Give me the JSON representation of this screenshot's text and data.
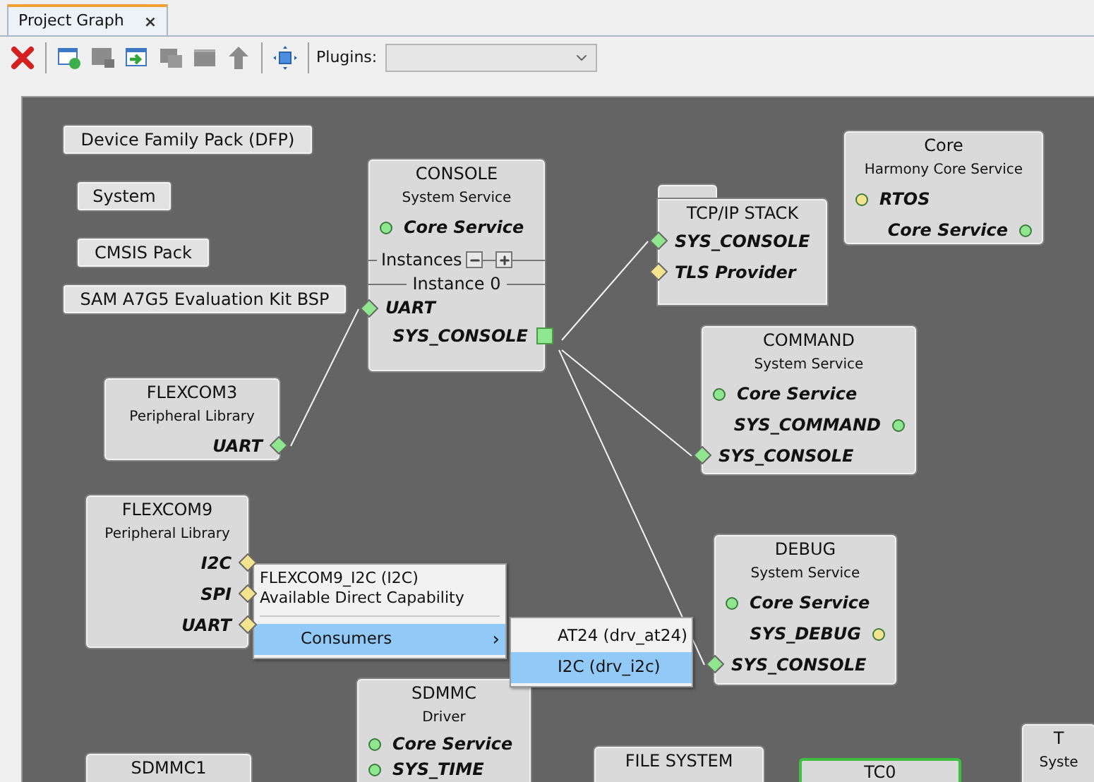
{
  "tab": {
    "label": "Project Graph",
    "close": "×",
    "selected": true
  },
  "toolbar": [
    {
      "kind": "delete",
      "disabled": false
    },
    {
      "kind": "new",
      "disabled": false
    },
    {
      "kind": "remove",
      "disabled": true
    },
    {
      "kind": "import",
      "disabled": false
    },
    {
      "kind": "copy",
      "disabled": true
    },
    {
      "kind": "panel",
      "disabled": true
    },
    {
      "kind": "up",
      "disabled": true
    },
    {
      "kind": "fit",
      "disabled": false
    }
  ],
  "plugins": {
    "label": "Plugins:",
    "disabled": true
  },
  "nodes": [
    {
      "kind": "pack",
      "title": "Device Family Pack (DFP)"
    },
    {
      "kind": "pack",
      "title": "System"
    },
    {
      "kind": "pack",
      "title": "CMSIS Pack"
    },
    {
      "kind": "pack",
      "title": "SAM A7G5 Evaluation Kit BSP"
    },
    {
      "kind": "component",
      "title": "CONSOLE",
      "subtitle": "System Service",
      "selected": false,
      "ports": [
        {
          "label": "Core Service",
          "kind": "dot",
          "on_right": false,
          "color": "#8ee68e"
        }
      ],
      "instances": {
        "label": "Instances",
        "instance": "Instance 0",
        "ports": [
          {
            "label": "UART",
            "kind": "diamond",
            "on_right": false,
            "color": "#8ee68e"
          },
          {
            "label": "SYS_CONSOLE",
            "kind": "square",
            "on_right": true,
            "color": "#8ee68e"
          }
        ]
      }
    },
    {
      "kind": "folder",
      "title": "TCP/IP STACK",
      "selected": false,
      "ports": [
        {
          "label": "SYS_CONSOLE",
          "kind": "diamond",
          "on_right": false,
          "color": "#8ee68e"
        },
        {
          "label": "TLS Provider",
          "kind": "diamond",
          "on_right": false,
          "color": "#f5e48e"
        }
      ]
    },
    {
      "kind": "component",
      "title": "Core",
      "subtitle": "Harmony Core Service",
      "selected": false,
      "ports": [
        {
          "label": "RTOS",
          "kind": "dot",
          "on_right": false,
          "color": "#f5e48e"
        },
        {
          "label": "Core Service",
          "kind": "dot",
          "on_right": true,
          "color": "#8ee68e"
        }
      ]
    },
    {
      "kind": "component",
      "title": "COMMAND",
      "subtitle": "System Service",
      "selected": false,
      "ports": [
        {
          "label": "Core Service",
          "kind": "dot",
          "on_right": false,
          "color": "#8ee68e"
        },
        {
          "label": "SYS_COMMAND",
          "kind": "dot",
          "on_right": true,
          "color": "#8ee68e"
        },
        {
          "label": "SYS_CONSOLE",
          "kind": "diamond",
          "on_right": false,
          "color": "#8ee68e"
        }
      ]
    },
    {
      "kind": "component",
      "title": "FLEXCOM3",
      "subtitle": "Peripheral Library",
      "selected": false,
      "ports": [
        {
          "label": "UART",
          "kind": "diamond",
          "on_right": true,
          "color": "#8ee68e"
        }
      ]
    },
    {
      "kind": "component",
      "title": "FLEXCOM9",
      "subtitle": "Peripheral Library",
      "selected": false,
      "ports": [
        {
          "label": "I2C",
          "kind": "diamond",
          "on_right": true,
          "color": "#f5e48e"
        },
        {
          "label": "SPI",
          "kind": "diamond",
          "on_right": true,
          "color": "#f5e48e"
        },
        {
          "label": "UART",
          "kind": "diamond",
          "on_right": true,
          "color": "#f5e48e"
        }
      ]
    },
    {
      "kind": "component",
      "title": "DEBUG",
      "subtitle": "System Service",
      "selected": false,
      "ports": [
        {
          "label": "Core Service",
          "kind": "dot",
          "on_right": false,
          "color": "#8ee68e"
        },
        {
          "label": "SYS_DEBUG",
          "kind": "dot",
          "on_right": true,
          "color": "#f5e48e"
        },
        {
          "label": "SYS_CONSOLE",
          "kind": "diamond",
          "on_right": false,
          "color": "#8ee68e"
        }
      ]
    },
    {
      "kind": "component",
      "title": "SDMMC1",
      "selected": false
    },
    {
      "kind": "component",
      "title": "SDMMC",
      "subtitle": "Driver",
      "selected": false,
      "ports": [
        {
          "label": "Core Service",
          "kind": "dot",
          "on_right": false,
          "color": "#8ee68e"
        },
        {
          "label": "SYS_TIME",
          "kind": "dot",
          "on_right": false,
          "color": "#8ee68e"
        }
      ]
    },
    {
      "kind": "component",
      "title": "FILE SYSTEM",
      "selected": false
    },
    {
      "kind": "component",
      "title": "TC0",
      "selected": true
    },
    {
      "kind": "component",
      "title": "T",
      "subtitle": "Syste",
      "selected": false
    }
  ],
  "context_menu": {
    "header": "FLEXCOM9_I2C (I2C)",
    "subheader": "Available Direct Capability",
    "items": [
      {
        "label": "Consumers",
        "arrow": "›",
        "selected": true
      }
    ],
    "submenu": [
      {
        "label": "AT24 (drv_at24)",
        "selected": false
      },
      {
        "label": "I2C (drv_i2c)",
        "selected": true
      }
    ]
  }
}
